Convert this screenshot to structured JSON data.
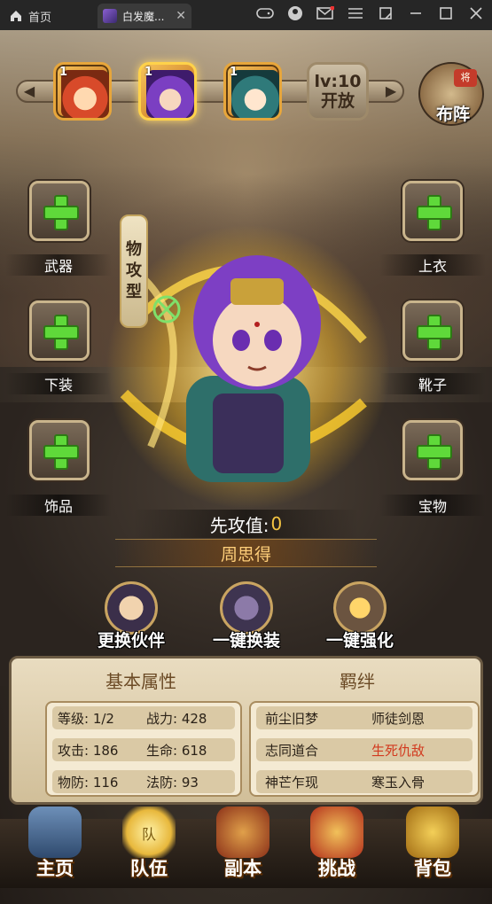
{
  "browser": {
    "home_tab": "首页",
    "game_tab": "白发魔...",
    "close": "✕",
    "icons": [
      "gamepad-icon",
      "user-icon",
      "mail-icon",
      "menu-icon",
      "restore-icon",
      "minimize-icon",
      "maximize-icon",
      "close-window-icon"
    ]
  },
  "top_bar": {
    "heroes": [
      {
        "level": "1"
      },
      {
        "level": "1"
      },
      {
        "level": "1"
      }
    ],
    "open_slot": {
      "line1": "lv:10",
      "line2": "开放"
    },
    "formation": {
      "badge": "将",
      "label": "布阵"
    }
  },
  "equipment": {
    "weapon": "武器",
    "top": "上衣",
    "bottom": "下装",
    "boots": "靴子",
    "accessory": "饰品",
    "treasure": "宝物"
  },
  "hero": {
    "type_chars": [
      "物",
      "攻",
      "型"
    ],
    "initiative_label": "先攻值:",
    "initiative_value": "0",
    "name": "周思得"
  },
  "actions": {
    "swap_partner": "更换伙伴",
    "auto_equip": "一键换装",
    "auto_enhance": "一键强化"
  },
  "attributes": {
    "title": "基本属性",
    "rows": [
      {
        "a": "等级: 1/2",
        "b": "战力: 428"
      },
      {
        "a": "攻击: 186",
        "b": "生命: 618"
      },
      {
        "a": "物防: 116",
        "b": "法防: 93"
      }
    ]
  },
  "bonds": {
    "title": "羁绊",
    "rows": [
      {
        "a": "前尘旧梦",
        "b": "师徒剑恩"
      },
      {
        "a": "志同道合",
        "b": "生死仇敌"
      },
      {
        "a": "神芒乍现",
        "b": "寒玉入骨"
      }
    ]
  },
  "nav": {
    "home": "主页",
    "team": "队伍",
    "dungeon": "副本",
    "challenge": "挑战",
    "bag": "背包",
    "team_flag": "队"
  },
  "colors": {
    "accent_gold": "#f5c542",
    "plus_green": "#5fd93a",
    "bond_red": "#d23a1f"
  }
}
